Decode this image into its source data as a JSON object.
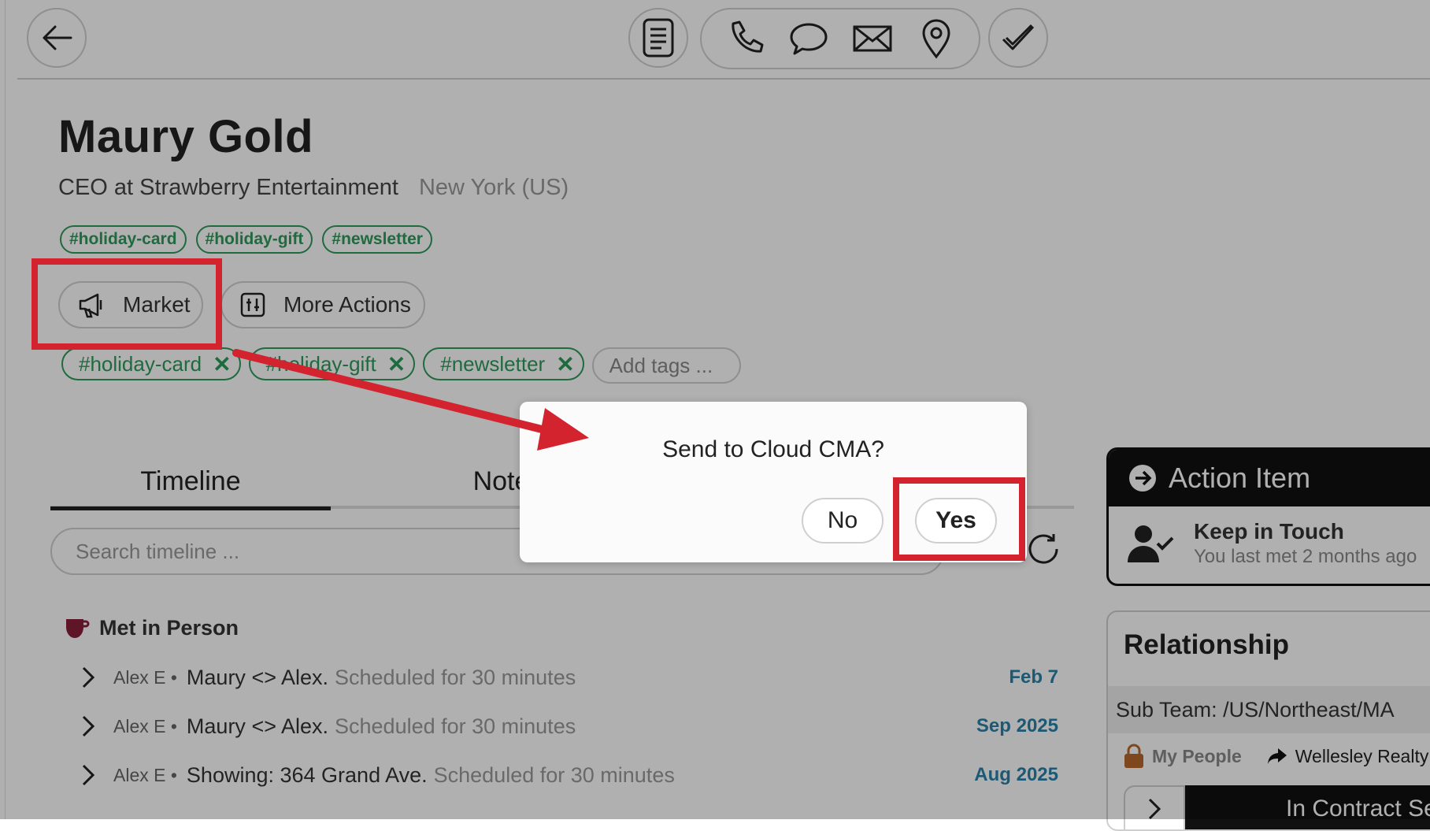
{
  "contact": {
    "name": "Maury Gold",
    "title": "CEO at Strawberry Entertainment",
    "location": "New York (US)",
    "tags": [
      "#holiday-card",
      "#holiday-gift",
      "#newsletter"
    ]
  },
  "actions": {
    "market_label": "Market",
    "more_label": "More Actions"
  },
  "tag_editor": {
    "tags": [
      "#holiday-card",
      "#holiday-gift",
      "#newsletter"
    ],
    "remove_glyph": "✕",
    "add_placeholder": "Add tags ..."
  },
  "tabs": [
    "Timeline",
    "Notes"
  ],
  "search": {
    "placeholder": "Search timeline ..."
  },
  "timeline": {
    "group_title": "Met in Person",
    "rows": [
      {
        "who": "Alex E •",
        "main": "Maury <> Alex.",
        "meta": "Scheduled for 30 minutes",
        "date": "Feb 7"
      },
      {
        "who": "Alex E •",
        "main": "Maury <> Alex.",
        "meta": "Scheduled for 30 minutes",
        "date": "Sep 2025"
      },
      {
        "who": "Alex E •",
        "main": "Showing: 364 Grand Ave.",
        "meta": "Scheduled for 30 minutes",
        "date": "Aug 2025"
      }
    ]
  },
  "action_item": {
    "header": "Action Item",
    "title": "Keep in Touch",
    "subtitle": "You last met 2 months ago"
  },
  "relationship": {
    "title": "Relationship",
    "sub_team": "Sub Team: /US/Northeast/MA",
    "people_label": "My People",
    "realty_label": "Wellesley Realty",
    "stage_label": "In Contract Se"
  },
  "dialog": {
    "message": "Send to Cloud CMA?",
    "no_label": "No",
    "yes_label": "Yes"
  },
  "colors": {
    "tag_green": "#2e9a5a",
    "highlight_red": "#d2232e",
    "date_blue": "#2a82a8",
    "mug": "#8a1f3a",
    "lock": "#b8682a"
  }
}
